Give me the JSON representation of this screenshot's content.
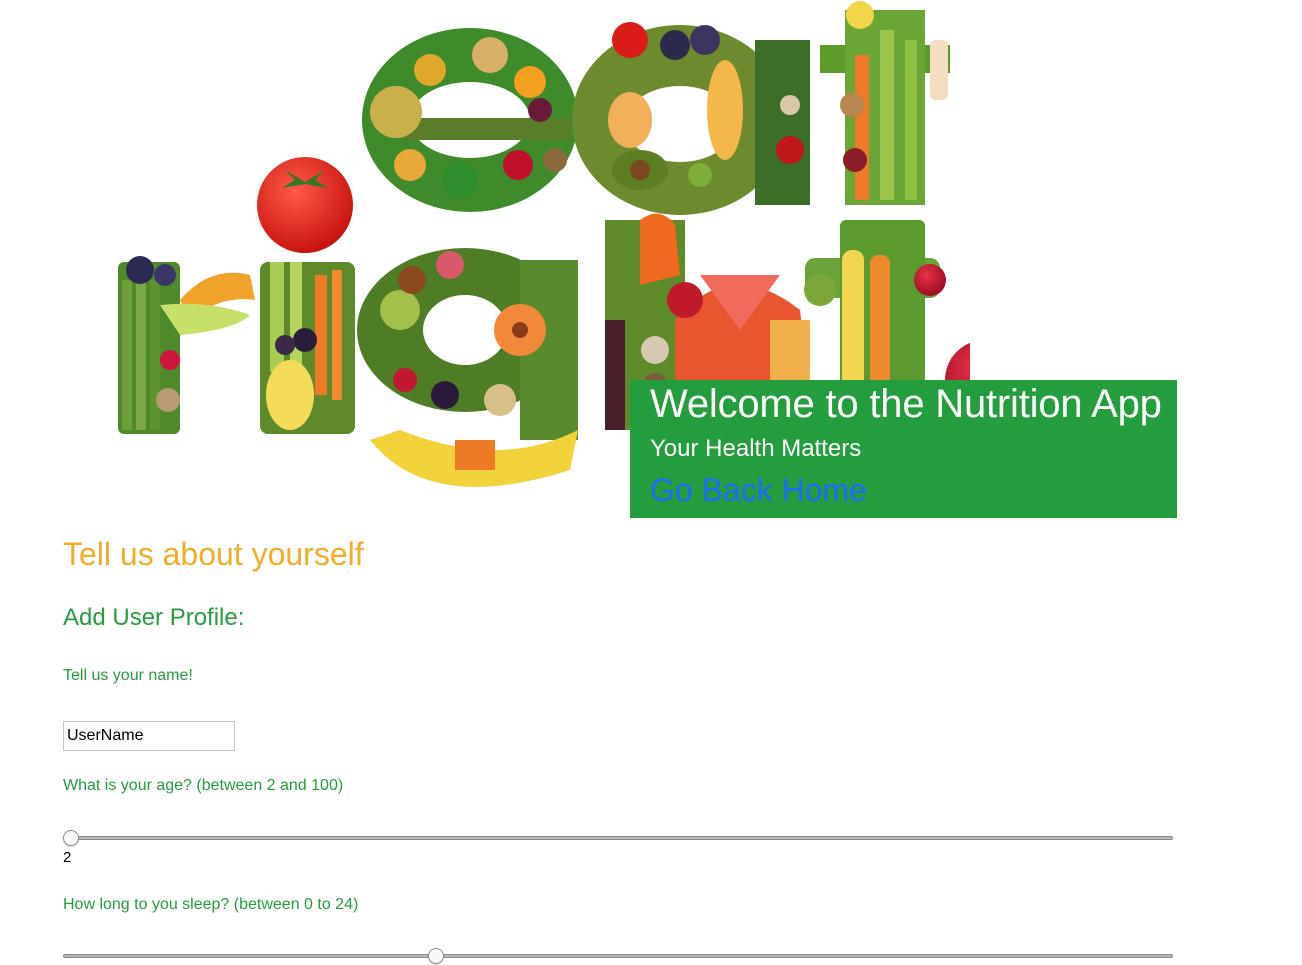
{
  "banner": {
    "title": "Welcome to the Nutrition App",
    "subtitle": "Your Health Matters",
    "home_link": "Go Back Home",
    "background": "#239d3d",
    "link_color": "#1a6bff"
  },
  "hero": {
    "image": "eat-right-vegetable-lettering",
    "icon_name": "eat-right-produce-illustration"
  },
  "form": {
    "section_heading": "Tell us about yourself",
    "profile_heading": "Add User Profile:",
    "name_label": "Tell us your name!",
    "name_value": "UserName",
    "age_label": "What is your age? (between 2 and 100)",
    "age": {
      "min": 2,
      "max": 100,
      "value": 2,
      "display": "2"
    },
    "sleep_label": "How long to you sleep? (between 0 to 24)",
    "sleep": {
      "min": 0,
      "max": 24,
      "value": 8
    }
  },
  "colors": {
    "heading_orange": "#f3ab28",
    "label_green": "#239d3d"
  }
}
